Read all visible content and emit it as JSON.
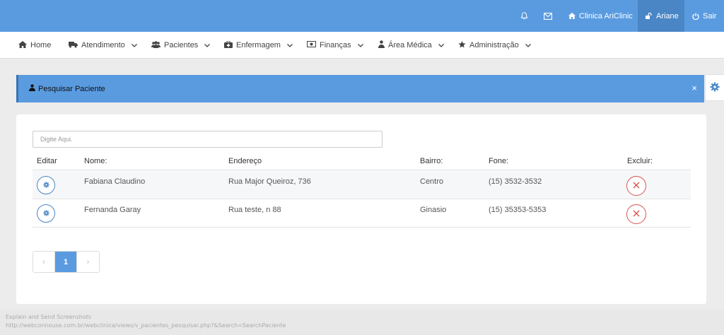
{
  "topbar": {
    "clinic_label": "Clinica AriClinic",
    "user_label": "Ariane",
    "logout_label": "Sair"
  },
  "menu": [
    {
      "label": "Home",
      "icon": "home-icon"
    },
    {
      "label": "Atendimento",
      "icon": "truck-icon"
    },
    {
      "label": "Pacientes",
      "icon": "users-icon"
    },
    {
      "label": "Enfermagem",
      "icon": "medkit-icon"
    },
    {
      "label": "Finanças",
      "icon": "money-icon"
    },
    {
      "label": "Área Médica",
      "icon": "doctor-icon"
    },
    {
      "label": "Administração",
      "icon": "star-icon"
    }
  ],
  "search_panel": {
    "title": "Pesquisar Paciente",
    "close_label": "×",
    "input_placeholder": "Digite Aqui."
  },
  "table": {
    "headers": {
      "edit": "Editar",
      "name": "Nome:",
      "address": "Endereço",
      "district": "Bairro:",
      "phone": "Fone:",
      "delete": "Excluir:"
    },
    "rows": [
      {
        "name": "Fabiana Claudino",
        "address": "Rua Major Queiroz, 736",
        "district": "Centro",
        "phone": "(15) 3532-3532"
      },
      {
        "name": "Fernanda Garay",
        "address": "Rua teste, n 88",
        "district": "Ginasio",
        "phone": "(15) 35353-5353"
      }
    ]
  },
  "pagination": {
    "prev": "‹",
    "current": "1",
    "next": "›"
  },
  "statusbar": {
    "line1": "Explain and Send Screenshots",
    "line2": "http://webconnouse.com.br/webclinica/views/v_pacientes_pesquisar.php?&Search=SearchPaciente"
  },
  "colors": {
    "primary": "#5a9be0",
    "primary_dark": "#4a86c5",
    "danger": "#d9534f"
  }
}
